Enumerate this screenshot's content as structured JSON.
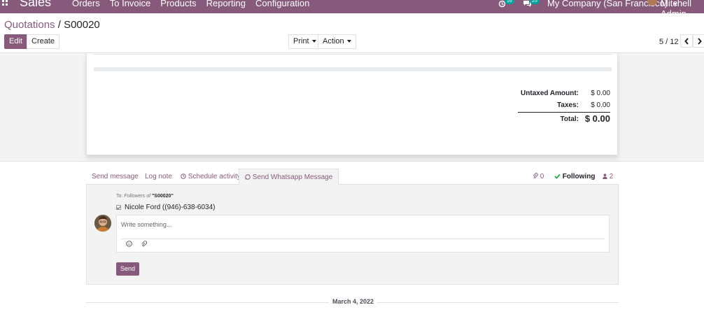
{
  "navbar": {
    "brand": "Sales",
    "menu": [
      "Orders",
      "To Invoice",
      "Products",
      "Reporting",
      "Configuration"
    ],
    "activity_count": "16",
    "message_count": "25",
    "company": "My Company (San Francisco)",
    "user": "Mitchell Admin",
    "accent_color": "#875a7b"
  },
  "breadcrumb": {
    "parent": "Quotations",
    "separator": "/",
    "current": "S00020"
  },
  "toolbar": {
    "edit_label": "Edit",
    "create_label": "Create",
    "print_label": "Print",
    "action_label": "Action"
  },
  "pager": {
    "value": "5 / 12"
  },
  "totals": {
    "untaxed_label": "Untaxed Amount:",
    "untaxed_value": "$ 0.00",
    "taxes_label": "Taxes:",
    "taxes_value": "$ 0.00",
    "total_label": "Total:",
    "total_value": "$ 0.00"
  },
  "chatter": {
    "tabs": [
      "Send message",
      "Log note",
      "Schedule activity",
      "Send Whatsapp Message"
    ],
    "attachments_count": "0",
    "following_label": "Following",
    "followers_count": "2",
    "to_prefix": "To:",
    "to_followers": "Followers of",
    "to_record": "\"S00020\"",
    "recipient": "Nicole Ford ((946)-638-6034)",
    "placeholder": "Write something...",
    "send_label": "Send",
    "date_separator": "March 4, 2022"
  }
}
